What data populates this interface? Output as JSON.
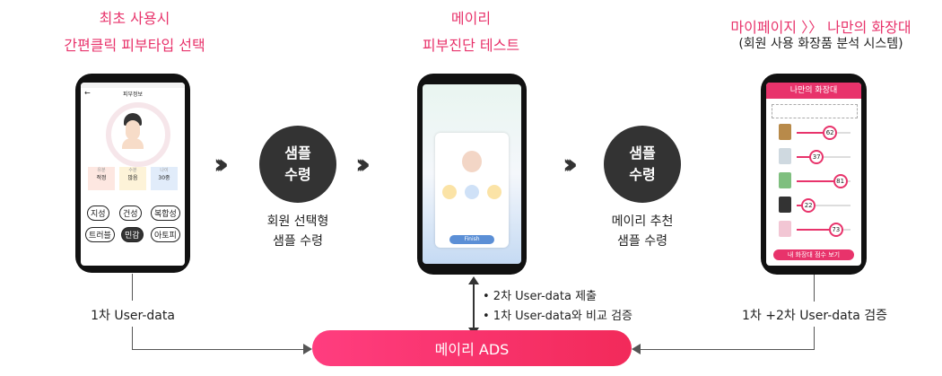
{
  "left_column": {
    "title_line1": "최초 사용시",
    "title_line2": "간편클릭 피부타입 선택",
    "phone": {
      "header": "피부정보",
      "labels": [
        "유분",
        "수분",
        "나이"
      ],
      "values": [
        "적정",
        "많음",
        "30중"
      ],
      "skin_types_row1": [
        "지성",
        "건성",
        "복합성"
      ],
      "skin_types_row2": [
        "트러블",
        "민감",
        "아토피"
      ]
    },
    "caption": "1차 User-data"
  },
  "step1": {
    "circle_line1": "샘플",
    "circle_line2": "수령",
    "caption_line1": "회원 선택형",
    "caption_line2": "샘플 수령"
  },
  "middle_column": {
    "title_line1": "메이리",
    "title_line2": "피부진단 테스트",
    "phone": {
      "button": "Finish"
    },
    "notes": [
      "• 2차 User-data 제출",
      "• 1차 User-data와 비교 검증"
    ]
  },
  "step2": {
    "circle_line1": "샘플",
    "circle_line2": "수령",
    "caption_line1": "메이리 추천",
    "caption_line2": "샘플 수령"
  },
  "right_column": {
    "title": "마이페이지 〉〉 나만의 화장대",
    "subtitle": "(회원 사용 화장품 분석 시스템)",
    "phone": {
      "header": "나만의 화장대",
      "scores": [
        62,
        37,
        81,
        22,
        73
      ],
      "button": "내 화장대 점수 보기"
    },
    "caption": "1차 +2차 User-data 검증"
  },
  "ads_label": "메이리 ADS",
  "colors": {
    "accent": "#e8336b",
    "dark": "#333333"
  }
}
